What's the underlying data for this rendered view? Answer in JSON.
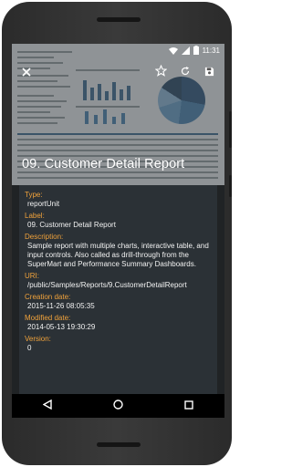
{
  "status_bar": {
    "time": "11:31",
    "icons": [
      "wifi-icon",
      "signal-icon",
      "battery-icon"
    ]
  },
  "toolbar": {
    "icons": [
      "close-icon",
      "star-outline-icon",
      "refresh-icon",
      "save-icon"
    ]
  },
  "report": {
    "title": "09. Customer Detail Report"
  },
  "details": [
    {
      "label": "Type:",
      "value": "reportUnit"
    },
    {
      "label": "Label:",
      "value": "09. Customer Detail Report"
    },
    {
      "label": "Description:",
      "value": "Sample report with multiple charts, interactive table, and input controls. Also called as drill-through from the SuperMart and Performance Summary Dashboards."
    },
    {
      "label": "URI:",
      "value": "/public/Samples/Reports/9.CustomerDetailReport"
    },
    {
      "label": "Creation date:",
      "value": "2015-11-26 08:05:35"
    },
    {
      "label": "Modified date:",
      "value": "2014-05-13 19:30:29"
    },
    {
      "label": "Version:",
      "value": "0"
    }
  ],
  "nav_bar": {
    "icons": [
      "back-icon",
      "home-icon",
      "recents-icon"
    ]
  },
  "colors": {
    "accent": "#f0a23b",
    "panel": "#2b3136",
    "screen_bg": "#202325"
  }
}
